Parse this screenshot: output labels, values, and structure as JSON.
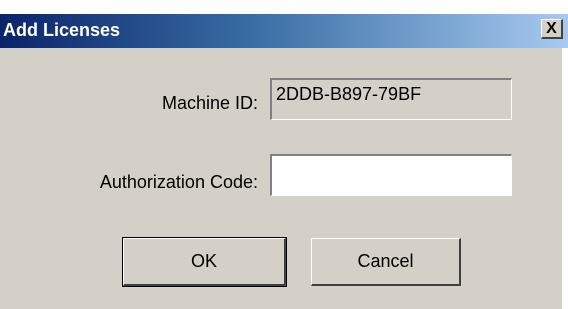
{
  "window": {
    "title": "Add Licenses",
    "close_label": "X"
  },
  "form": {
    "machine_id_label": "Machine ID:",
    "machine_id_value": "2DDB-B897-79BF",
    "auth_code_label": "Authorization Code:",
    "auth_code_value": ""
  },
  "buttons": {
    "ok_label": "OK",
    "cancel_label": "Cancel"
  },
  "colors": {
    "dialog_bg": "#d4d0c8",
    "title_start": "#0a246a",
    "title_end": "#a6caf0"
  }
}
